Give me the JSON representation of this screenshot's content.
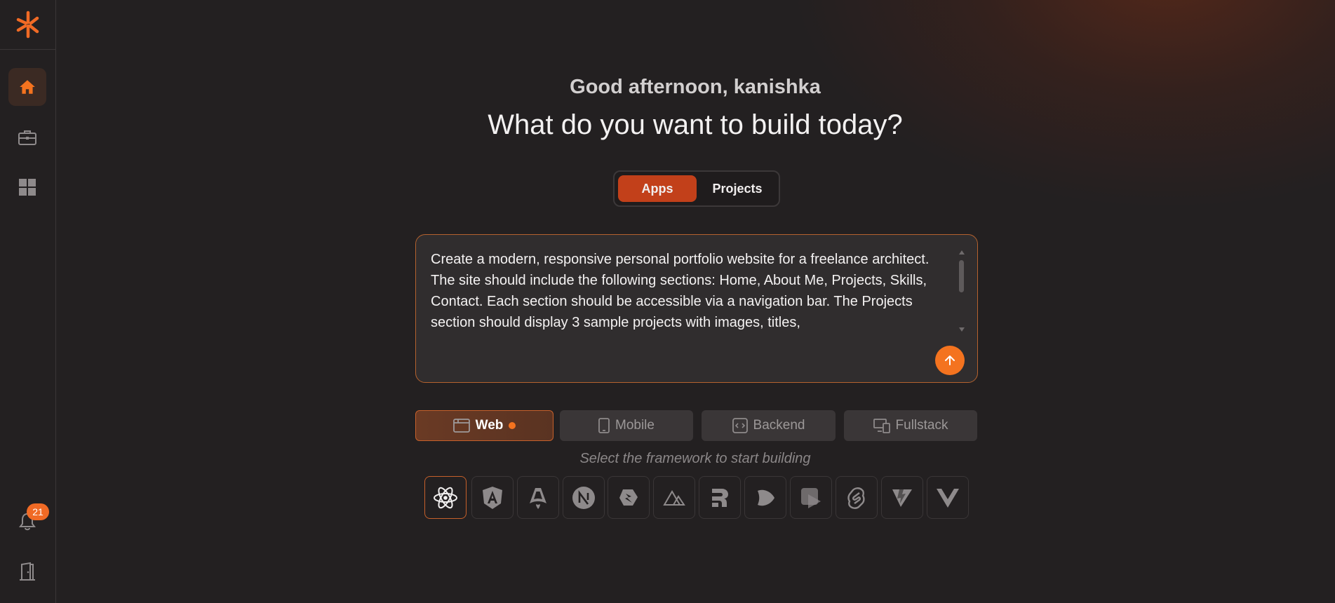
{
  "greeting": "Good afternoon, kanishka",
  "headline": "What do you want to build today?",
  "mode_toggle": {
    "apps_label": "Apps",
    "projects_label": "Projects",
    "selected": "Apps"
  },
  "prompt": {
    "value": "Create a modern, responsive personal portfolio website for a freelance architect. The site should include the following sections: Home, About Me, Projects, Skills, Contact. Each section should be accessible via a navigation bar. The Projects section should display 3 sample projects with images, titles,"
  },
  "app_types": [
    {
      "label": "Web",
      "icon": "browser-window-icon",
      "active": true
    },
    {
      "label": "Mobile",
      "icon": "mobile-phone-icon",
      "active": false
    },
    {
      "label": "Backend",
      "icon": "code-bracket-icon",
      "active": false
    },
    {
      "label": "Fullstack",
      "icon": "devices-icon",
      "active": false
    }
  ],
  "framework_hint": "Select the framework to start building",
  "frameworks": [
    {
      "name": "React",
      "icon": "react-icon",
      "selected": true
    },
    {
      "name": "Angular",
      "icon": "angular-icon",
      "selected": false
    },
    {
      "name": "Astro",
      "icon": "astro-icon",
      "selected": false
    },
    {
      "name": "Next.js",
      "icon": "nextjs-icon",
      "selected": false
    },
    {
      "name": "Qwik",
      "icon": "qwik-icon",
      "selected": false
    },
    {
      "name": "Nuxt",
      "icon": "nuxt-icon",
      "selected": false
    },
    {
      "name": "Remix",
      "icon": "remix-icon",
      "selected": false
    },
    {
      "name": "SolidStart",
      "icon": "solid-icon",
      "selected": false
    },
    {
      "name": "Storybook",
      "icon": "storybook-icon",
      "selected": false
    },
    {
      "name": "Svelte",
      "icon": "svelte-icon",
      "selected": false
    },
    {
      "name": "Vite",
      "icon": "vite-icon",
      "selected": false
    },
    {
      "name": "Vue",
      "icon": "vue-icon",
      "selected": false
    }
  ],
  "sidebar": {
    "items": [
      {
        "icon": "home-icon",
        "active": true
      },
      {
        "icon": "briefcase-icon",
        "active": false
      },
      {
        "icon": "grid-icon",
        "active": false
      }
    ],
    "notifications_count": "21",
    "logout_icon": "door-icon"
  },
  "colors": {
    "accent": "#f4731f",
    "accent_dark": "#c2401a",
    "background": "#232021"
  }
}
